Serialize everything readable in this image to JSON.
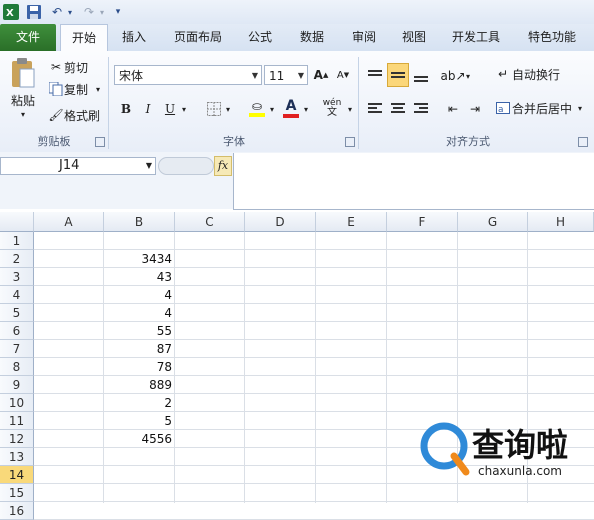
{
  "app": {
    "accent_file_tab": "#3a8a37"
  },
  "qat": {
    "excel_icon": "excel-logo-icon",
    "save": "save-icon",
    "undo": "undo-icon",
    "redo": "redo-icon",
    "customize": "customize-icon"
  },
  "tabs": [
    {
      "label": "文件"
    },
    {
      "label": "开始"
    },
    {
      "label": "插入"
    },
    {
      "label": "页面布局"
    },
    {
      "label": "公式"
    },
    {
      "label": "数据"
    },
    {
      "label": "审阅"
    },
    {
      "label": "视图"
    },
    {
      "label": "开发工具"
    },
    {
      "label": "特色功能"
    }
  ],
  "ribbon": {
    "clipboard": {
      "paste": "粘贴",
      "cut": "剪切",
      "copy": "复制",
      "format_painter": "格式刷",
      "group": "剪贴板"
    },
    "font": {
      "name": "宋体",
      "size": "11",
      "bold": "B",
      "italic": "I",
      "underline": "U",
      "font_color": "A",
      "phonetic": "wén",
      "group": "字体"
    },
    "align": {
      "wrap": "自动换行",
      "merge": "合并后居中",
      "group": "对齐方式"
    }
  },
  "formula_bar": {
    "namebox": "J14",
    "fx": "fx"
  },
  "sheet": {
    "columns": [
      "A",
      "B",
      "C",
      "D",
      "E",
      "F",
      "G",
      "H"
    ],
    "rows": [
      "1",
      "2",
      "3",
      "4",
      "5",
      "6",
      "7",
      "8",
      "9",
      "10",
      "11",
      "12",
      "13",
      "14",
      "15",
      "16"
    ],
    "selected_row": "14",
    "b_values": [
      "",
      "3434",
      "43",
      "4",
      "4",
      "55",
      "87",
      "78",
      "889",
      "2",
      "5",
      "4556",
      "",
      "",
      "",
      ""
    ]
  },
  "watermark": {
    "text": "查询啦",
    "url": "chaxunla.com"
  }
}
